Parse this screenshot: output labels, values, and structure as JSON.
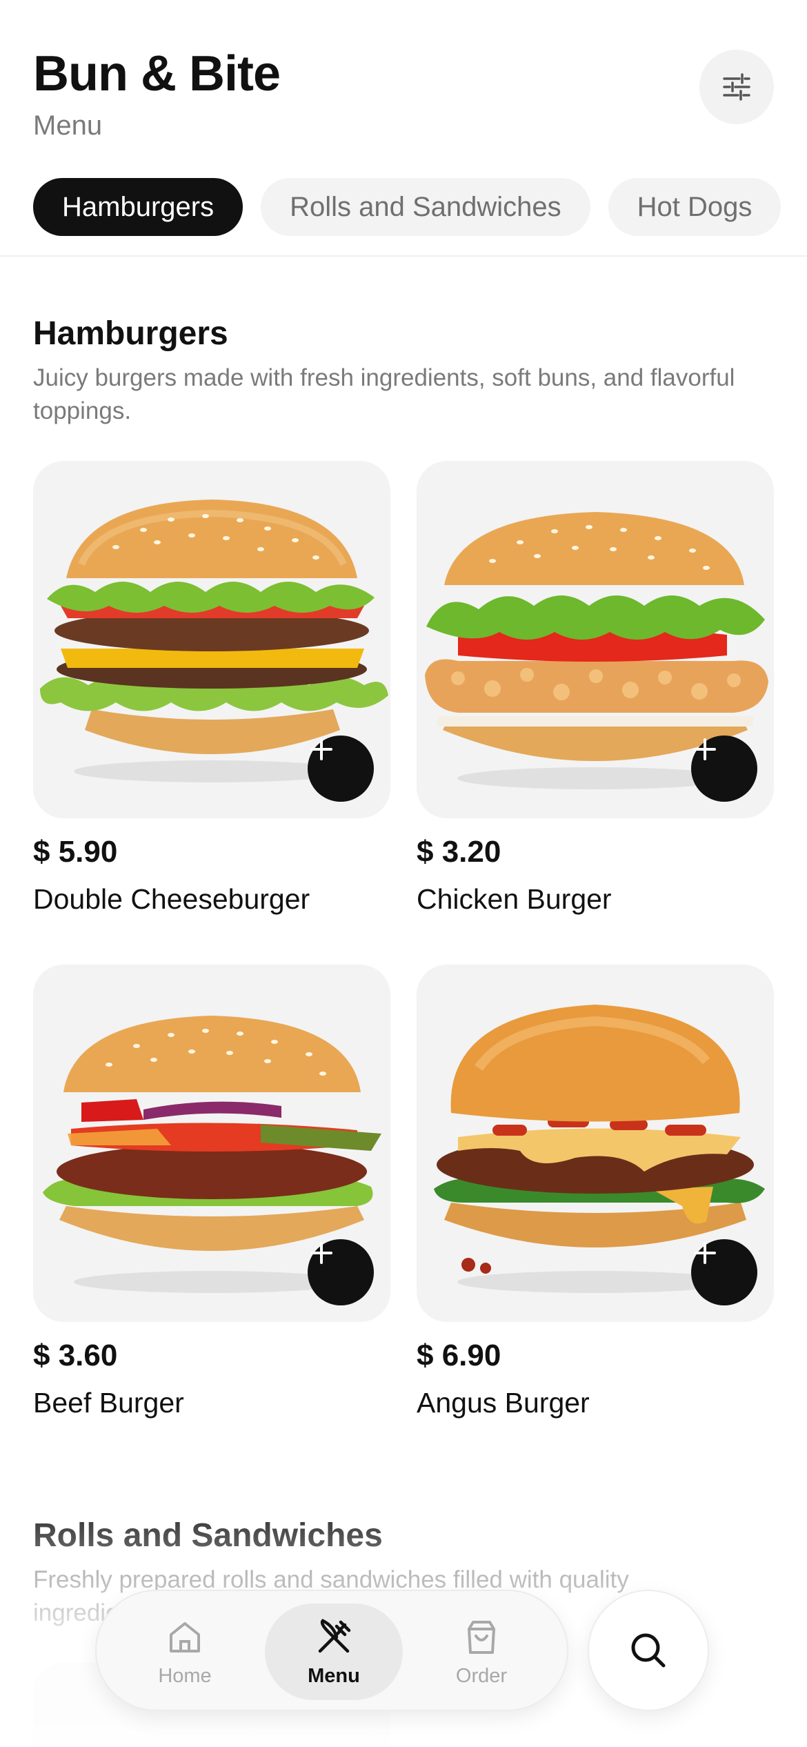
{
  "header": {
    "title": "Bun & Bite",
    "subtitle": "Menu",
    "filter_icon": "sliders-icon"
  },
  "tabs": [
    {
      "label": "Hamburgers",
      "active": true
    },
    {
      "label": "Rolls and Sandwiches",
      "active": false
    },
    {
      "label": "Hot Dogs",
      "active": false
    }
  ],
  "sections": [
    {
      "title": "Hamburgers",
      "description": "Juicy burgers made with fresh ingredients, soft buns, and flavorful toppings.",
      "items": [
        {
          "price": "$ 5.90",
          "name": "Double Cheeseburger",
          "image": "double-cheeseburger-image"
        },
        {
          "price": "$ 3.20",
          "name": "Chicken Burger",
          "image": "chicken-burger-image"
        },
        {
          "price": "$ 3.60",
          "name": "Beef Burger",
          "image": "beef-burger-image"
        },
        {
          "price": "$ 6.90",
          "name": "Angus Burger",
          "image": "angus-burger-image"
        }
      ]
    },
    {
      "title": "Rolls and Sandwiches",
      "description": "Freshly prepared rolls and sandwiches filled with quality ingredients."
    }
  ],
  "bottom_nav": {
    "items": [
      {
        "label": "Home",
        "icon": "home-icon",
        "active": false
      },
      {
        "label": "Menu",
        "icon": "fork-knife-icon",
        "active": true
      },
      {
        "label": "Order",
        "icon": "shopping-bag-icon",
        "active": false
      }
    ],
    "search_icon": "search-icon"
  },
  "colors": {
    "accent": "#111111",
    "muted_text": "#7a7a7a",
    "card_bg": "#f3f3f3",
    "chip_bg": "#f3f3f3"
  }
}
